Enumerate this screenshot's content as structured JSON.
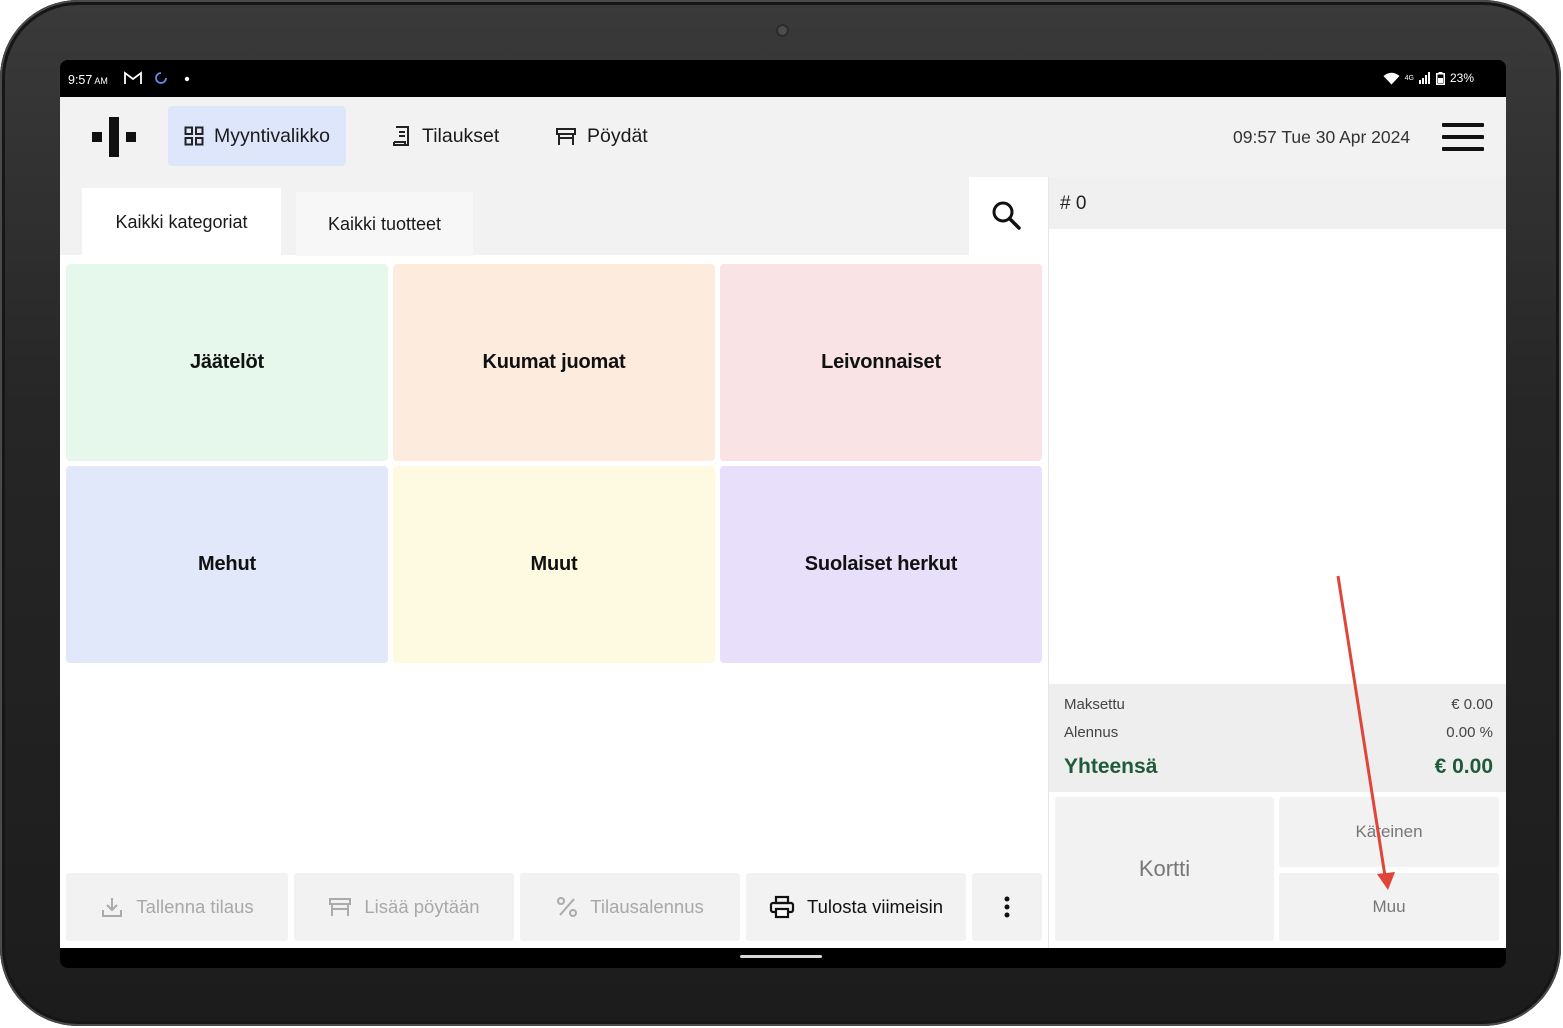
{
  "status_bar": {
    "time": "9:57",
    "ampm": "AM",
    "network": "4G",
    "battery": "23%"
  },
  "nav": {
    "items": [
      {
        "label": "Myyntivalikko",
        "icon": "grid-icon",
        "active": true
      },
      {
        "label": "Tilaukset",
        "icon": "receipt-icon",
        "active": false
      },
      {
        "label": "Pöydät",
        "icon": "table-icon",
        "active": false
      }
    ],
    "datetime": "09:57 Tue 30 Apr 2024"
  },
  "tabs": [
    {
      "label": "Kaikki kategoriat",
      "active": true
    },
    {
      "label": "Kaikki tuotteet",
      "active": false
    }
  ],
  "categories": [
    {
      "label": "Jäätelöt",
      "color": "#e6f7ec"
    },
    {
      "label": "Kuumat juomat",
      "color": "#fdebde"
    },
    {
      "label": "Leivonnaiset",
      "color": "#f9e3e5"
    },
    {
      "label": "Mehut",
      "color": "#e0e8fa"
    },
    {
      "label": "Muut",
      "color": "#fef9e1"
    },
    {
      "label": "Suolaiset herkut",
      "color": "#e8e0fb"
    }
  ],
  "actions": {
    "save": "Tallenna tilaus",
    "add_table": "Lisää pöytään",
    "discount": "Tilausalennus",
    "print": "Tulosta viimeisin"
  },
  "order": {
    "number": "# 0",
    "paid_label": "Maksettu",
    "paid_value": "€ 0.00",
    "discount_label": "Alennus",
    "discount_value": "0.00 %",
    "total_label": "Yhteensä",
    "total_value": "€ 0.00"
  },
  "payment": {
    "card": "Kortti",
    "cash": "Käteinen",
    "other": "Muu"
  },
  "colors": {
    "accent_active": "#dde6fb",
    "total_green": "#1f5a3a",
    "arrow_red": "#e0453a"
  }
}
